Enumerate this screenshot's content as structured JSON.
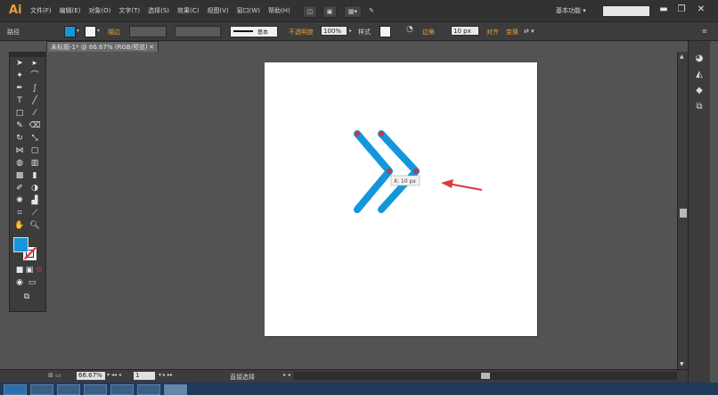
{
  "app": {
    "logo": "Ai"
  },
  "menu": [
    "文件(F)",
    "编辑(E)",
    "对象(O)",
    "文字(T)",
    "选择(S)",
    "效果(C)",
    "视图(V)",
    "窗口(W)",
    "帮助(H)"
  ],
  "workspace": {
    "label": "基本功能 ▾"
  },
  "window_controls": {
    "minimize": "▬",
    "restore": "❐",
    "close": "✕"
  },
  "control_bar": {
    "selection_label": "路径",
    "stroke_link": "描边",
    "stroke_style": "基本",
    "opacity_link": "不透明度",
    "opacity_value": "100%",
    "style_label": "样式",
    "corner_link": "边角",
    "corner_value": "10 px",
    "align_link": "对齐",
    "transform_link": "变换"
  },
  "document_tab": {
    "title": "未标题-1* @ 66.67% (RGB/预览)",
    "close": "✕"
  },
  "tooltip": {
    "text": "X: 10 px"
  },
  "status": {
    "zoom": "66.67%",
    "page": "1",
    "tool_text": "直接选择"
  },
  "colors": {
    "accent_fill": "#1496dc",
    "anchor": "#c0394b",
    "arrow": "#e03a3a",
    "link": "#e8a13a"
  }
}
